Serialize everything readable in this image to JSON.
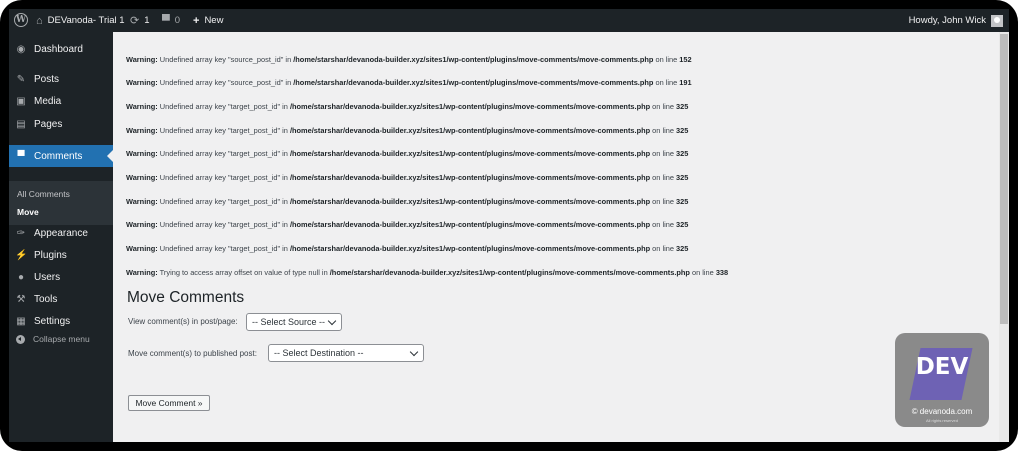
{
  "adminbar": {
    "site_name": "DEVanoda- Trial 1",
    "updates_count": "1",
    "comments_count": "0",
    "new_label": "New",
    "howdy": "Howdy, John Wick"
  },
  "sidebar": {
    "items": [
      {
        "label": "Dashboard"
      },
      {
        "label": "Posts"
      },
      {
        "label": "Media"
      },
      {
        "label": "Pages"
      },
      {
        "label": "Comments"
      },
      {
        "label": "Appearance"
      },
      {
        "label": "Plugins"
      },
      {
        "label": "Users"
      },
      {
        "label": "Tools"
      },
      {
        "label": "Settings"
      }
    ],
    "submenu": [
      {
        "label": "All Comments"
      },
      {
        "label": "Move"
      }
    ],
    "collapse": "Collapse menu"
  },
  "warnings": [
    {
      "prefix": "Warning:",
      "message": " Undefined array key \"source_post_id\" in ",
      "path": "/home/starshar/devanoda-builder.xyz/sites1/wp-content/plugins/move-comments/move-comments.php",
      "online": " on line ",
      "line": "152"
    },
    {
      "prefix": "Warning:",
      "message": " Undefined array key \"source_post_id\" in ",
      "path": "/home/starshar/devanoda-builder.xyz/sites1/wp-content/plugins/move-comments/move-comments.php",
      "online": " on line ",
      "line": "191"
    },
    {
      "prefix": "Warning:",
      "message": " Undefined array key \"target_post_id\" in ",
      "path": "/home/starshar/devanoda-builder.xyz/sites1/wp-content/plugins/move-comments/move-comments.php",
      "online": " on line ",
      "line": "325"
    },
    {
      "prefix": "Warning:",
      "message": " Undefined array key \"target_post_id\" in ",
      "path": "/home/starshar/devanoda-builder.xyz/sites1/wp-content/plugins/move-comments/move-comments.php",
      "online": " on line ",
      "line": "325"
    },
    {
      "prefix": "Warning:",
      "message": " Undefined array key \"target_post_id\" in ",
      "path": "/home/starshar/devanoda-builder.xyz/sites1/wp-content/plugins/move-comments/move-comments.php",
      "online": " on line ",
      "line": "325"
    },
    {
      "prefix": "Warning:",
      "message": " Undefined array key \"target_post_id\" in ",
      "path": "/home/starshar/devanoda-builder.xyz/sites1/wp-content/plugins/move-comments/move-comments.php",
      "online": " on line ",
      "line": "325"
    },
    {
      "prefix": "Warning:",
      "message": " Undefined array key \"target_post_id\" in ",
      "path": "/home/starshar/devanoda-builder.xyz/sites1/wp-content/plugins/move-comments/move-comments.php",
      "online": " on line ",
      "line": "325"
    },
    {
      "prefix": "Warning:",
      "message": " Undefined array key \"target_post_id\" in ",
      "path": "/home/starshar/devanoda-builder.xyz/sites1/wp-content/plugins/move-comments/move-comments.php",
      "online": " on line ",
      "line": "325"
    },
    {
      "prefix": "Warning:",
      "message": " Undefined array key \"target_post_id\" in ",
      "path": "/home/starshar/devanoda-builder.xyz/sites1/wp-content/plugins/move-comments/move-comments.php",
      "online": " on line ",
      "line": "325"
    },
    {
      "prefix": "Warning:",
      "message": " Trying to access array offset on value of type null in ",
      "path": "/home/starshar/devanoda-builder.xyz/sites1/wp-content/plugins/move-comments/move-comments.php",
      "online": " on line ",
      "line": "338"
    }
  ],
  "main": {
    "title": "Move Comments",
    "view_label": "View comment(s) in post/page:",
    "source_select": "-- Select Source --",
    "move_label": "Move comment(s) to published post:",
    "destination_select": "-- Select Destination --",
    "button": "Move Comment »"
  },
  "watermark": {
    "logo_text": "DEV",
    "site": "© devanoda.com",
    "rights": "All rights reserved"
  },
  "colors": {
    "admin_bar": "#1d2327",
    "sidebar": "#1d2327",
    "active": "#2271b1",
    "background": "#f0f0f1"
  }
}
